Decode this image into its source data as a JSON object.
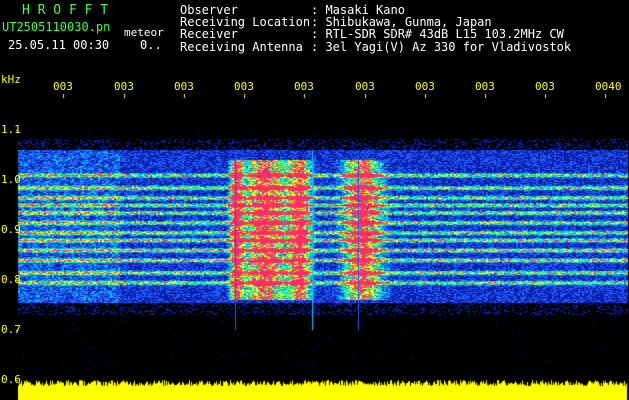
{
  "header": {
    "app_name": "H R O F F T",
    "filename": "UT2505110030.pn",
    "mode": "meteor",
    "datetime": "25.05.11 00:30",
    "count": "0..",
    "info_labels": [
      "Observer",
      "Receiving Location",
      "Receiver",
      "Receiving Antenna"
    ],
    "info_values": [
      ": Masaki Kano",
      ": Shibukawa, Gunma, Japan",
      ": RTL-SDR SDR# 43dB L15 103.2MHz CW",
      ": 3el Yagi(V) Az 330 for Vladivostok"
    ]
  },
  "time_axis": {
    "ticks": [
      "003",
      "003",
      "003",
      "003",
      "003",
      "003",
      "003",
      "003",
      "003",
      "0040"
    ]
  },
  "freq_axis": {
    "unit": "kHz",
    "ticks": [
      "1.1",
      "1.0",
      "0.9",
      "0.8",
      "0.7",
      "0.6"
    ]
  },
  "colors": {
    "header_green": "#3cff3c",
    "header_white": "#ffffff",
    "axis_yellow": "#ffff00",
    "background": "#000000"
  },
  "chart_data": {
    "type": "heatmap",
    "xlabel": "",
    "ylabel": "kHz",
    "ylim": [
      0.6,
      1.15
    ],
    "x_ticks": [
      "003",
      "003",
      "003",
      "003",
      "003",
      "003",
      "003",
      "003",
      "003",
      "0040"
    ],
    "y_ticks": [
      1.1,
      1.0,
      0.9,
      0.8,
      0.7,
      0.6
    ],
    "signal_band_khz": [
      0.76,
      1.05
    ],
    "meteor_echoes_column_index": [
      4,
      5,
      6
    ]
  }
}
